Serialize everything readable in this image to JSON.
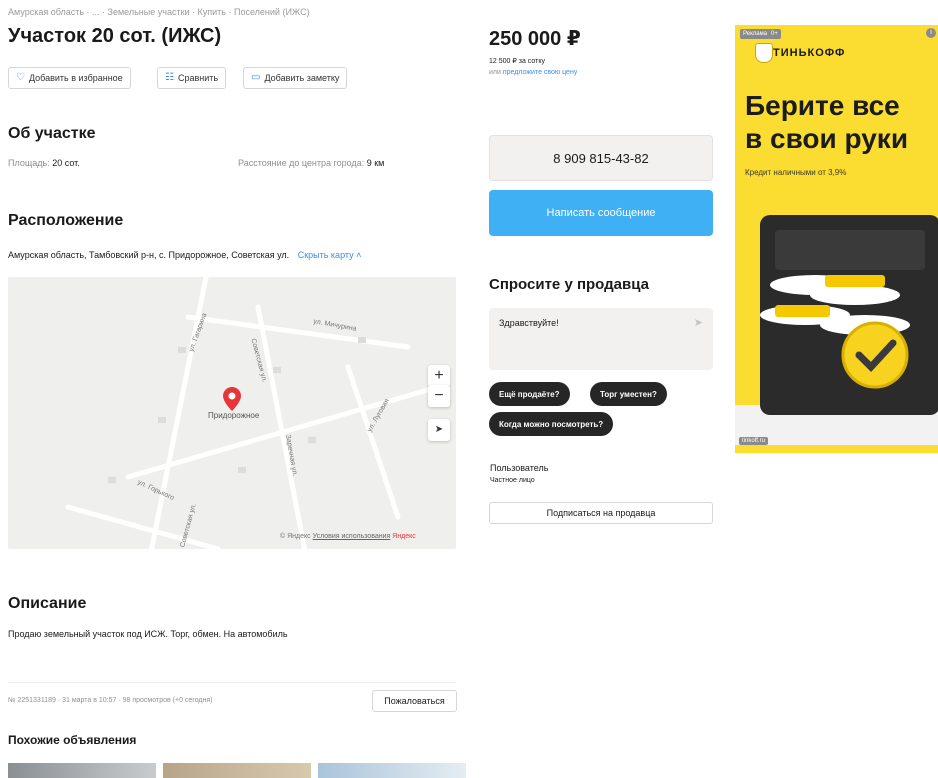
{
  "breadcrumb": "Амурская область · ... · Земельные участки · Купить · Поселений (ИЖС)",
  "title": "Участок 20 сот. (ИЖС)",
  "actions": {
    "favorite": "Добавить в избранное",
    "compare": "Сравнить",
    "note": "Добавить заметку"
  },
  "about": {
    "heading": "Об участке",
    "area_label": "Площадь:",
    "area_value": "20 сот.",
    "distance_label": "Расстояние до центра города:",
    "distance_value": "9 км"
  },
  "location": {
    "heading": "Расположение",
    "address": "Амурская область, Тамбовский р-н, с. Придорожное, Советская ул.",
    "hide_map": "Скрыть карту",
    "map": {
      "place_label": "Придорожное",
      "streets": [
        "ул. Гагарина",
        "Советская ул.",
        "ул. Мичурина",
        "ул. Луговая",
        "ул. Горького",
        "Советская ул.",
        "Заречная ул."
      ],
      "zoom_in": "+",
      "zoom_out": "−",
      "copyright": "© Яндекс",
      "terms": "Условия использования",
      "yandex": "Яндекс"
    }
  },
  "description": {
    "heading": "Описание",
    "text": "Продаю земельный участок под ИСЖ. Торг, обмен. На автомобиль"
  },
  "meta": {
    "info": "№ 2251331189 · 31 марта в 10:57 · 98 просмотров (+0 сегодня)",
    "report": "Пожаловаться"
  },
  "similar": {
    "heading": "Похожие объявления"
  },
  "sidebar": {
    "price": "250 000 ₽",
    "price_per": "12 500 ₽ за сотку",
    "offer_prefix": "или",
    "offer_link": "предложите свою цену",
    "phone": "8 909 815-43-82",
    "message": "Написать сообщение",
    "ask_heading": "Спросите у продавца",
    "ask_text": "Здравствуйте!",
    "chips": [
      "Ещё продаёте?",
      "Торг уместен?",
      "Когда можно посмотреть?"
    ],
    "seller_name": "Пользователь",
    "seller_type": "Частное лицо",
    "subscribe": "Подписаться на продавца"
  },
  "ad": {
    "tag_left": "Реклама",
    "tag_age": "0+",
    "brand": "ТИНЬКОФФ",
    "headline_1": "Берите все",
    "headline_2": "в свои руки",
    "subline": "Кредит наличными от 3,9%",
    "footer": "tinkoff.ru"
  },
  "colors": {
    "accent_blue": "#3fb0f3",
    "link_blue": "#3b8de8",
    "ad_yellow": "#fbdc31",
    "pin_red": "#e8353a"
  }
}
